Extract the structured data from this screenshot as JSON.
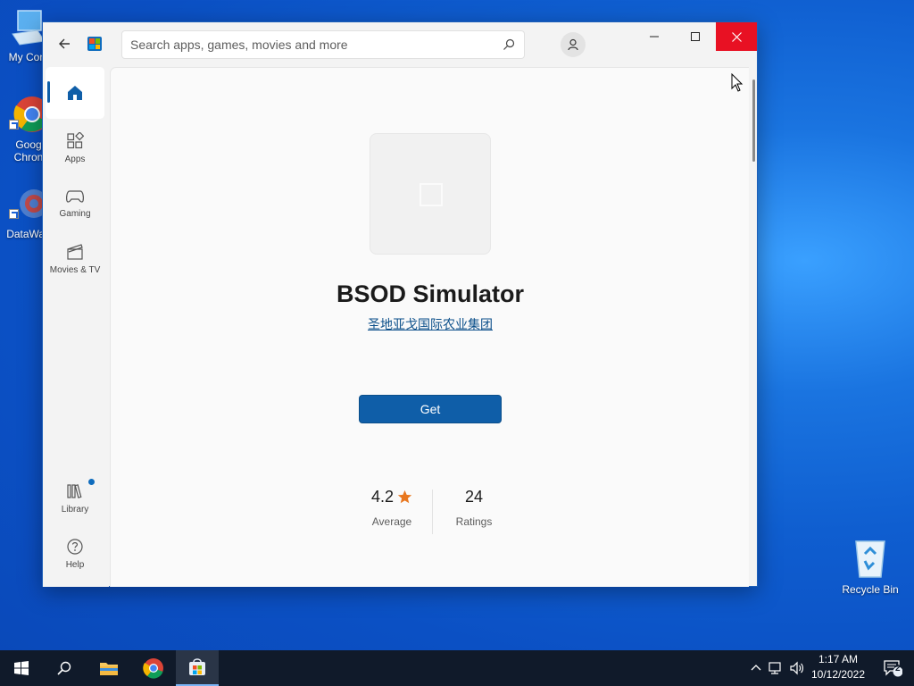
{
  "desktop": {
    "icons": [
      {
        "label": "My Com",
        "icon": "computer-icon"
      },
      {
        "label": "Goog\nChron",
        "icon": "chrome-icon"
      },
      {
        "label": "DataWag",
        "icon": "datawag-icon"
      },
      {
        "label": "Recycle Bin",
        "icon": "recycle-bin-icon"
      }
    ]
  },
  "store": {
    "search_placeholder": "Search apps, games, movies and more",
    "nav": [
      {
        "label": "",
        "icon": "home-icon",
        "active": true
      },
      {
        "label": "Apps",
        "icon": "apps-icon"
      },
      {
        "label": "Gaming",
        "icon": "gamepad-icon"
      },
      {
        "label": "Movies & TV",
        "icon": "film-icon"
      },
      {
        "label": "Library",
        "icon": "library-icon"
      },
      {
        "label": "Help",
        "icon": "help-icon"
      }
    ],
    "app": {
      "name": "BSOD Simulator",
      "publisher": "圣地亚戈国际农业集团",
      "get_label": "Get",
      "rating_value": "4.2",
      "rating_caption": "Average",
      "ratings_count": "24",
      "ratings_caption": "Ratings"
    }
  },
  "taskbar": {
    "time": "1:17 AM",
    "date": "10/12/2022",
    "notification_count": "2"
  },
  "colors": {
    "accent": "#0f5ea8",
    "close": "#e81123",
    "star": "#e8771f"
  }
}
